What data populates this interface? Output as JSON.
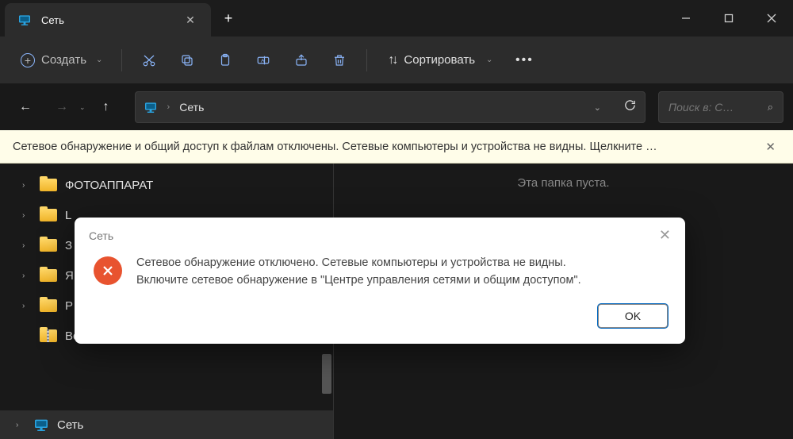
{
  "tab": {
    "title": "Сеть"
  },
  "toolbar": {
    "create": "Создать",
    "sort": "Сортировать"
  },
  "address": {
    "location": "Сеть"
  },
  "search": {
    "placeholder": "Поиск в: С…"
  },
  "infobar": {
    "message": "Сетевое обнаружение и общий доступ к файлам отключены. Сетевые компьютеры и устройства не видны. Щелкните …"
  },
  "tree": {
    "items": [
      {
        "label": "ФОТОАППАРАТ",
        "type": "folder"
      },
      {
        "label": "L",
        "type": "folder"
      },
      {
        "label": "З",
        "type": "folder"
      },
      {
        "label": "Я",
        "type": "folder"
      },
      {
        "label": "Р",
        "type": "folder"
      },
      {
        "label": "Все файлы с облака МАЙЛ РУ.zip",
        "type": "zip"
      }
    ],
    "footer": "Сеть"
  },
  "main": {
    "empty": "Эта папка пуста."
  },
  "dialog": {
    "title": "Сеть",
    "line1": "Сетевое обнаружение отключено. Сетевые компьютеры и устройства не видны.",
    "line2": "Включите сетевое обнаружение в \"Центре управления сетями и общим доступом\".",
    "ok": "OK"
  }
}
